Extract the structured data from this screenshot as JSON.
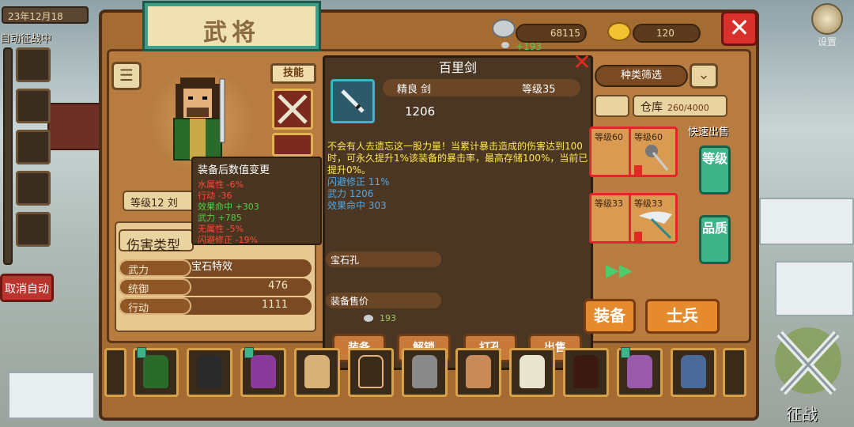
{
  "header": {
    "date": "23年12月18",
    "auto_campaign": "自动征战中",
    "title": "武将",
    "silver": "68115",
    "silver_gain": "+193",
    "gold": "120",
    "settings_label": "设置"
  },
  "hero": {
    "skill_label": "技能",
    "level": "等级12",
    "name_partial": "刘",
    "damage_type_label": "伤害类型",
    "stats": [
      {
        "name": "武力",
        "value": ""
      },
      {
        "name": "统御",
        "value": "476"
      },
      {
        "name": "行动",
        "value": "1111"
      }
    ]
  },
  "equip_change": {
    "title": "装备后数值变更",
    "lines": [
      {
        "text": "水属性 -6%",
        "color": "red"
      },
      {
        "text": "行动 -36",
        "color": "red"
      },
      {
        "text": "效果命中 +303",
        "color": "green"
      },
      {
        "text": "武力 +785",
        "color": "green"
      },
      {
        "text": "无属性 -5%",
        "color": "red"
      },
      {
        "text": "闪避修正 -19%",
        "color": "red"
      }
    ],
    "gem_effect": "宝石特效"
  },
  "item": {
    "name": "百里剑",
    "quality_type": "精良 剑",
    "level": "等级35",
    "power": "1206",
    "description": "不会有人去遗忘这一股力量！当累计暴击造成的伤害达到100时，可永久提升1%该装备的暴击率，最高存储100%，当前已提升0%。",
    "attrs": [
      "闪避修正 11%",
      "武力 1206",
      "效果命中 303"
    ],
    "gem_slot_label": "宝石孔",
    "sell_price_label": "装备售价",
    "sell_price": "193",
    "buttons": [
      "装备",
      "解锁",
      "打孔",
      "出售"
    ]
  },
  "inventory": {
    "filter_label": "种类筛选",
    "warehouse_label": "仓库",
    "warehouse_count": "260/4000",
    "quick_sell": "快速出售",
    "slot_levels": [
      "等级60",
      "等级60",
      "等级33",
      "等级33"
    ],
    "btn_level": "等级",
    "btn_quality": "品质",
    "tab_equip": "装备",
    "tab_soldier": "士兵"
  },
  "bottom": {
    "cancel_auto": "取消自动",
    "campaign": "征战"
  },
  "colors": {
    "frame": "#a46b33",
    "popup_bg": "#4a3622",
    "desc_yellow": "#ffe94a",
    "attr_blue": "#4fa8e8",
    "close_red": "#d8302a",
    "accent_green": "#3fb48a"
  }
}
